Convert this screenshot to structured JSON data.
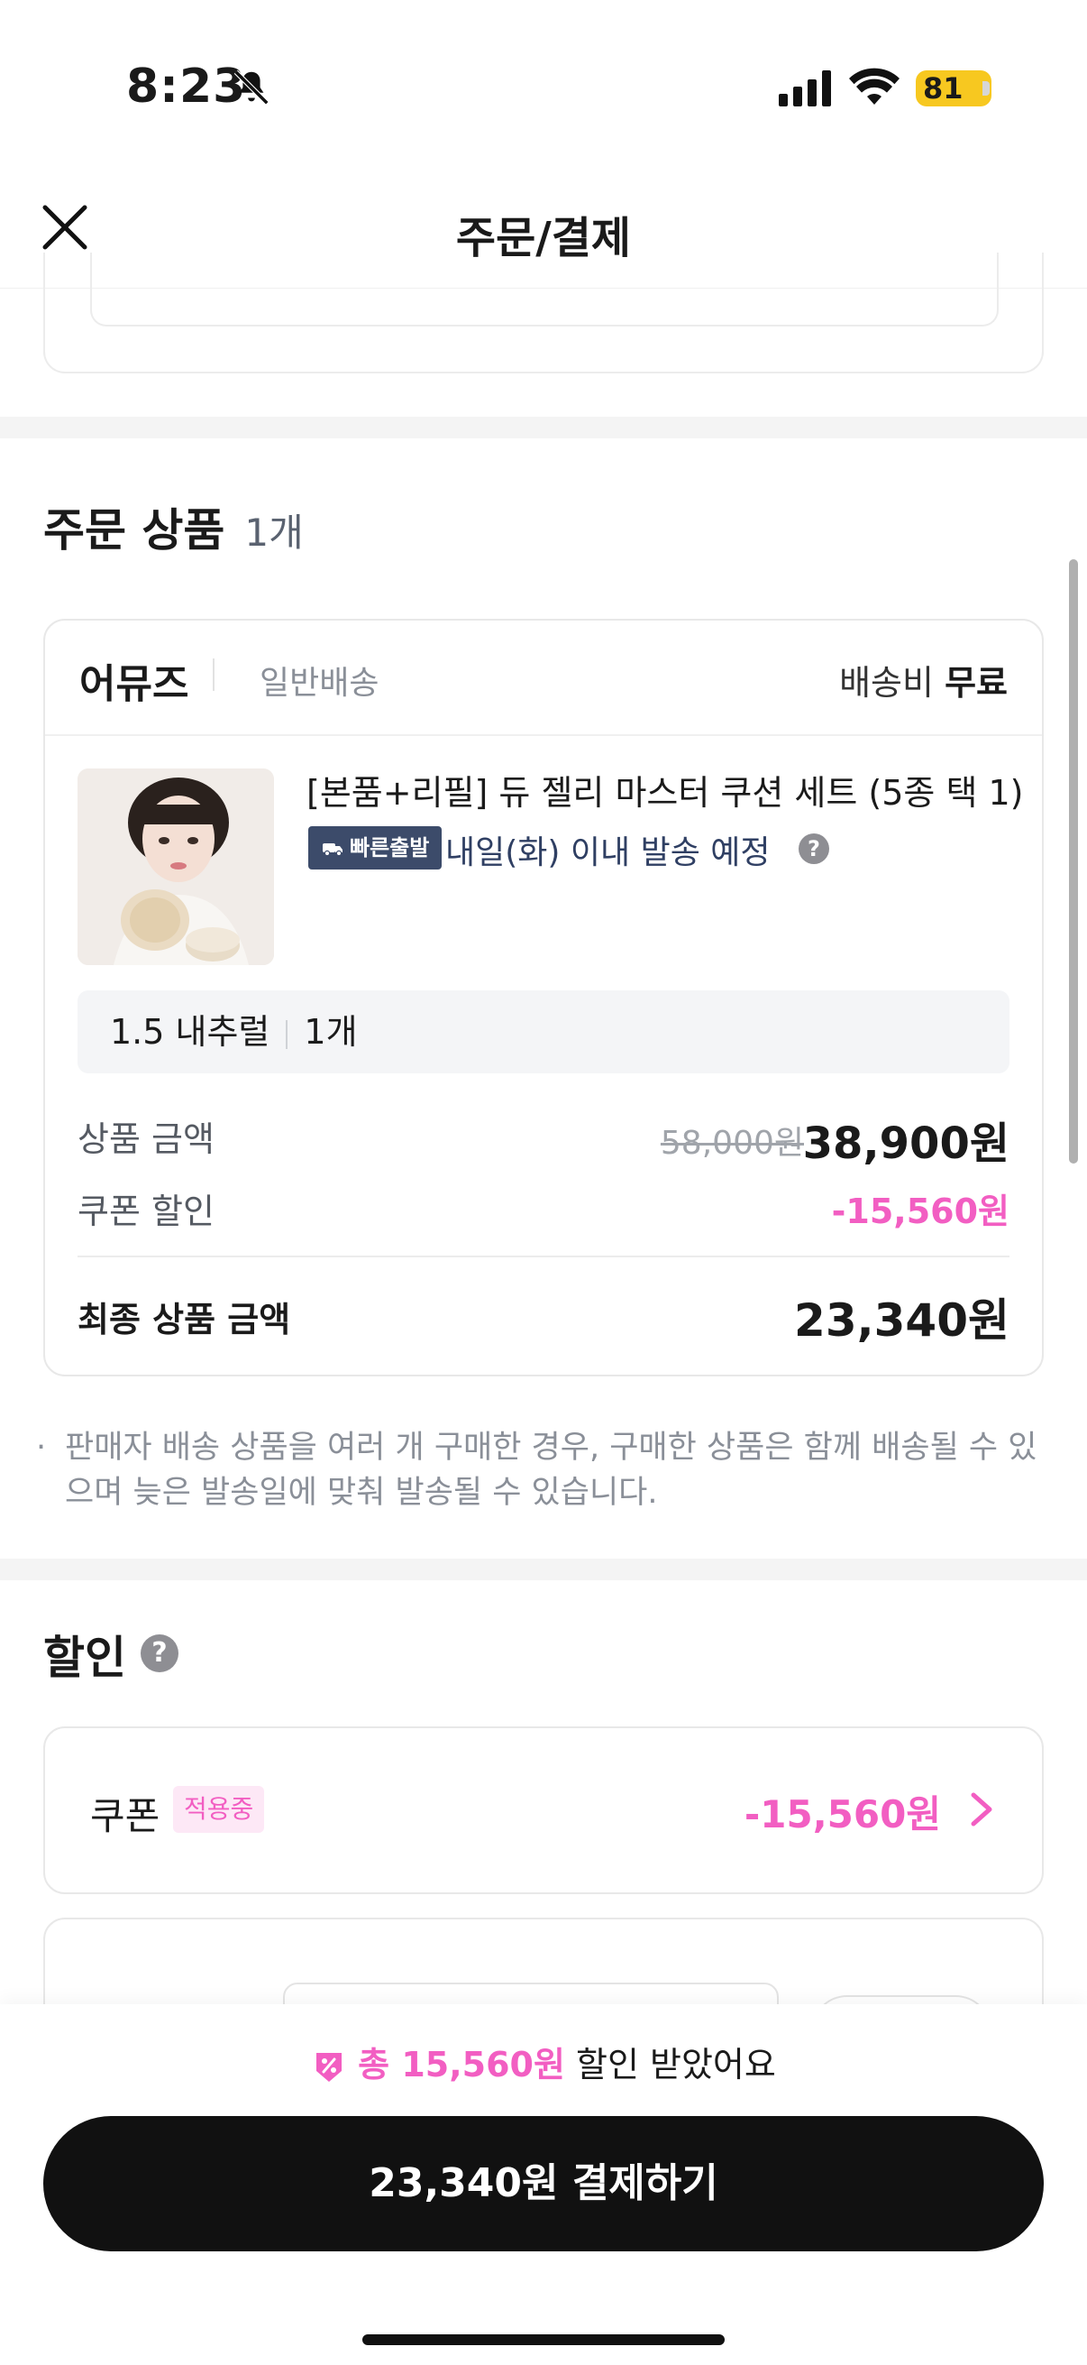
{
  "status": {
    "time": "8:23",
    "battery": "81"
  },
  "header": {
    "title": "주문/결제"
  },
  "order": {
    "section_title": "주문 상품",
    "count": "1개",
    "seller": "어뮤즈",
    "shipping_type": "일반배송",
    "shipping_fee_label": "배송비",
    "shipping_fee_value": "무료",
    "product_name": "[본품+리필] 듀 젤리 마스터 쿠션 세트 (5종 택 1)",
    "fast_badge": "빠른출발",
    "eta": "내일(화) 이내 발송 예정",
    "option": "1.5 내추럴",
    "option_qty": "1개",
    "price_label": "상품 금액",
    "original_price": "58,000원",
    "price": "38,900원",
    "coupon_label": "쿠폰 할인",
    "coupon_discount": "-15,560원",
    "final_label": "최종 상품 금액",
    "final_price": "23,340원",
    "notice": "판매자 배송 상품을 여러 개 구매한 경우, 구매한 상품은 함께 배송될 수 있으며 늦은 발송일에 맞춰 발송될 수 있습니다."
  },
  "discount": {
    "title": "할인",
    "coupon_label": "쿠폰",
    "applied_badge": "적용중",
    "coupon_amount": "-15,560원"
  },
  "bottom": {
    "total_prefix": "총 15,560원",
    "total_suffix": "할인 받았어요",
    "pay_button": "23,340원 결제하기"
  },
  "colors": {
    "accent_pink": "#f25ec2",
    "badge_navy": "#3c4b6a",
    "battery": "#f7c820"
  }
}
